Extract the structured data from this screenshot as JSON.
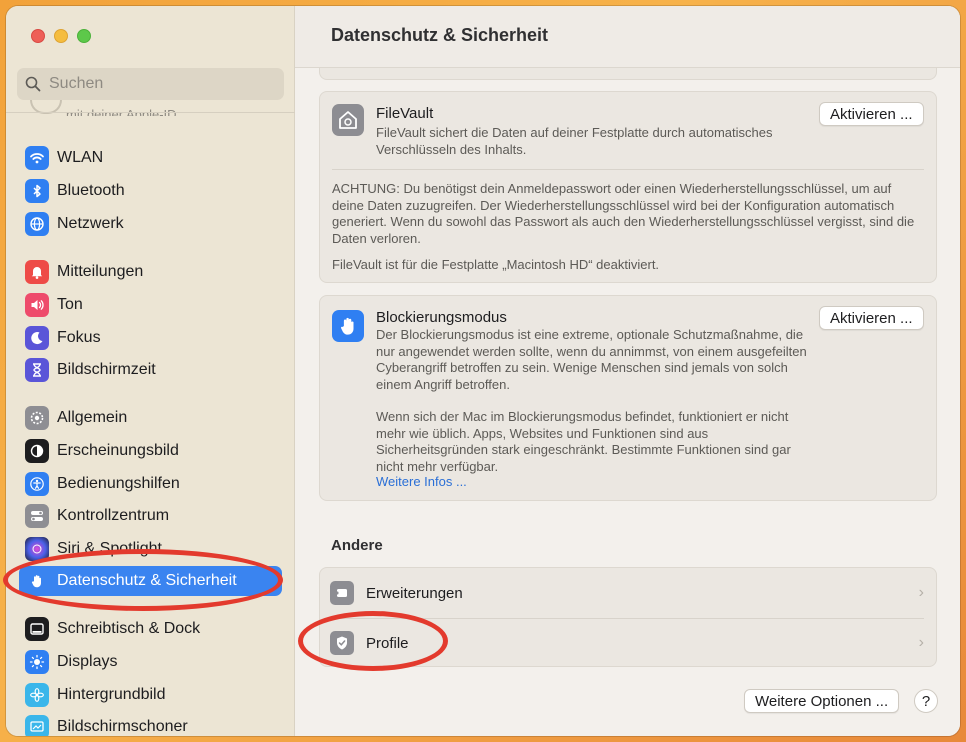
{
  "window": {
    "title": "Datenschutz & Sicherheit"
  },
  "search": {
    "placeholder": "Suchen"
  },
  "sidebar": {
    "clipped_text": "mit deiner Apple-ID",
    "items": [
      {
        "label": "WLAN",
        "icon": "wifi-icon",
        "color": "#2f7ff2"
      },
      {
        "label": "Bluetooth",
        "icon": "bluetooth-icon",
        "color": "#2f7ff2"
      },
      {
        "label": "Netzwerk",
        "icon": "globe-icon",
        "color": "#2f7ff2"
      },
      {
        "label": "Mitteilungen",
        "icon": "bell-icon",
        "color": "#ee4b47"
      },
      {
        "label": "Ton",
        "icon": "speaker-icon",
        "color": "#ee4b6b"
      },
      {
        "label": "Fokus",
        "icon": "moon-icon",
        "color": "#5a55d8"
      },
      {
        "label": "Bildschirmzeit",
        "icon": "hourglass-icon",
        "color": "#5a55d8"
      },
      {
        "label": "Allgemein",
        "icon": "gear-icon",
        "color": "#8e8e93"
      },
      {
        "label": "Erscheinungsbild",
        "icon": "appearance-icon",
        "color": "#1d1d1f"
      },
      {
        "label": "Bedienungshilfen",
        "icon": "accessibility-icon",
        "color": "#2f7ff2"
      },
      {
        "label": "Kontrollzentrum",
        "icon": "toggles-icon",
        "color": "#8e8e93"
      },
      {
        "label": "Siri & Spotlight",
        "icon": "siri-icon",
        "color": "#3c2a6b"
      },
      {
        "label": "Datenschutz & Sicherheit",
        "icon": "hand-icon",
        "color": "#3a84f0",
        "selected": true
      },
      {
        "label": "Schreibtisch & Dock",
        "icon": "dock-icon",
        "color": "#1d1d1f"
      },
      {
        "label": "Displays",
        "icon": "sun-icon",
        "color": "#2f7ff2"
      },
      {
        "label": "Hintergrundbild",
        "icon": "flower-icon",
        "color": "#3ab6ea"
      },
      {
        "label": "Bildschirmschoner",
        "icon": "screensaver-icon",
        "color": "#3ab6ea"
      }
    ]
  },
  "filevault": {
    "title": "FileVault",
    "description": "FileVault sichert die Daten auf deiner Festplatte durch automatisches Verschlüsseln des Inhalts.",
    "button": "Aktivieren ...",
    "warning": "ACHTUNG: Du benötigst dein Anmeldepasswort oder einen Wiederherstellungsschlüssel, um auf deine Daten zuzugreifen. Der Wiederherstellungsschlüssel wird bei der Konfiguration automatisch generiert. Wenn du sowohl das Passwort als auch den Wiederherstellungsschlüssel vergisst, sind die Daten verloren.",
    "status": "FileVault ist für die Festplatte „Macintosh HD“ deaktiviert."
  },
  "lockdown": {
    "title": "Blockierungsmodus",
    "description1": "Der Blockierungsmodus ist eine extreme, optionale Schutzmaßnahme, die nur angewendet werden sollte, wenn du annimmst, von einem ausgefeilten Cyberangriff betroffen zu sein. Wenige Menschen sind jemals von solch einem Angriff betroffen.",
    "description2": "Wenn sich der Mac im Blockierungsmodus befindet, funktioniert er nicht mehr wie üblich. Apps, Websites und Funktionen sind aus Sicherheitsgründen stark eingeschränkt. Bestimmte Funktionen sind gar nicht mehr verfügbar.",
    "link": "Weitere Infos ...",
    "button": "Aktivieren ..."
  },
  "other": {
    "section_title": "Andere",
    "rows": [
      {
        "label": "Erweiterungen",
        "icon": "extensions-icon"
      },
      {
        "label": "Profile",
        "icon": "profile-badge-icon"
      }
    ]
  },
  "footer": {
    "more_options": "Weitere Optionen ...",
    "help": "?"
  },
  "accent": {
    "selection": "#3a84f0",
    "highlight_ring": "#e33a2d"
  }
}
